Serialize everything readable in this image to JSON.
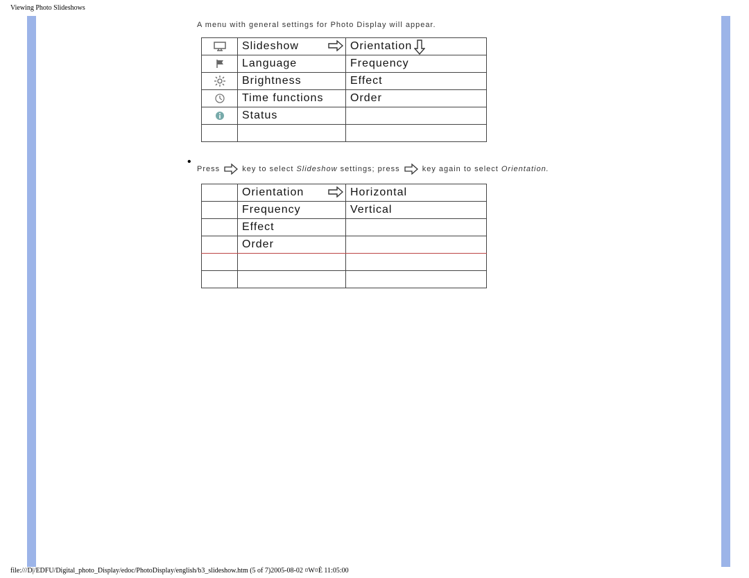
{
  "header_title": "Viewing Photo Slideshows",
  "intro": "A menu with general settings for Photo Display will appear.",
  "menu1": {
    "rows": [
      {
        "icon": "monitor",
        "main": "Slideshow",
        "sub": "Orientation",
        "sel_main": true,
        "sel_sub": true
      },
      {
        "icon": "flag",
        "main": "Language",
        "sub": "Frequency"
      },
      {
        "icon": "brightness",
        "main": "Brightness",
        "sub": "Effect"
      },
      {
        "icon": "clock",
        "main": "Time functions",
        "sub": "Order"
      },
      {
        "icon": "info",
        "main": "Status",
        "sub": ""
      },
      {
        "icon": "",
        "main": "",
        "sub": ""
      }
    ]
  },
  "step2": {
    "pre": "Press",
    "mid1": "key to select ",
    "ital1": "Slideshow",
    "mid2": " settings; press",
    "mid3": "key again to select ",
    "ital2": "Orientation."
  },
  "menu2": {
    "rows": [
      {
        "main": "Orientation",
        "sub": "Horizontal",
        "sel": true
      },
      {
        "main": "Frequency",
        "sub": "Vertical"
      },
      {
        "main": "Effect",
        "sub": ""
      },
      {
        "main": "Order",
        "sub": "",
        "redline": true
      },
      {
        "main": "",
        "sub": ""
      },
      {
        "main": "",
        "sub": ""
      }
    ]
  },
  "footer": "file:///D|/EDFU/Digital_photo_Display/edoc/PhotoDisplay/english/b3_slideshow.htm (5 of 7)2005-08-02 ¤W¤È 11:05:00"
}
